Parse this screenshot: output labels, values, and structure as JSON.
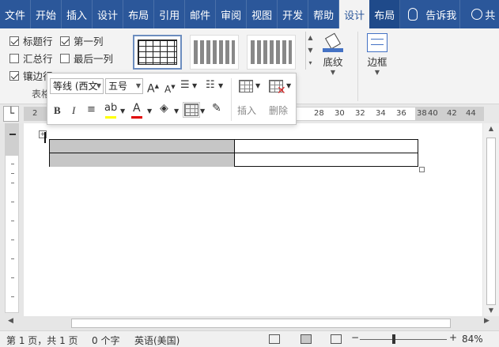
{
  "ribbon_tabs": [
    {
      "label": "文件"
    },
    {
      "label": "开始"
    },
    {
      "label": "插入"
    },
    {
      "label": "设计"
    },
    {
      "label": "布局"
    },
    {
      "label": "引用"
    },
    {
      "label": "邮件"
    },
    {
      "label": "审阅"
    },
    {
      "label": "视图"
    },
    {
      "label": "开发"
    },
    {
      "label": "帮助"
    },
    {
      "label": "设计"
    },
    {
      "label": "布局"
    }
  ],
  "tell_me": "告诉我",
  "share": "共",
  "style_options": {
    "header_row": "标题行",
    "first_column": "第一列",
    "total_row": "汇总行",
    "last_column": "最后一列",
    "banded_rows": "镶边行",
    "group_label": "表格"
  },
  "shading_label": "底纹",
  "borders_label": "边框",
  "ruler_numbers": [
    "2",
    "28",
    "30",
    "32",
    "34",
    "36",
    "38",
    "40",
    "42",
    "44"
  ],
  "mini_toolbar": {
    "font_name": "等线 (西文",
    "font_size": "五号",
    "bold": "B",
    "italic": "I",
    "insert_label": "插入",
    "delete_label": "删除"
  },
  "status_bar": {
    "page_info": "第 1 页，共 1 页",
    "word_count": "0 个字",
    "language": "英语(美国)",
    "zoom": "84%"
  }
}
